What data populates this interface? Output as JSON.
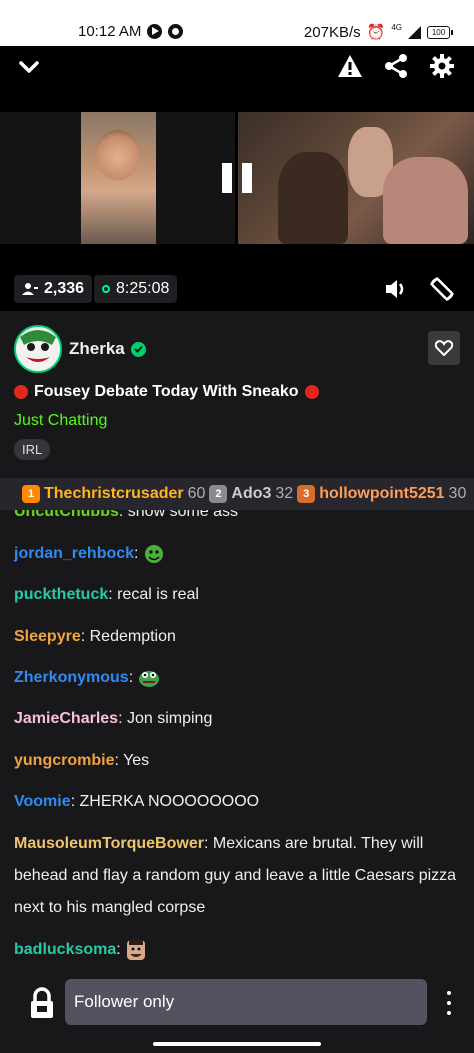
{
  "status_bar": {
    "time": "10:12 AM",
    "net_speed": "207KB/s",
    "network": "4G",
    "battery": "100"
  },
  "video": {
    "viewers": "2,336",
    "uptime": "8:25:08"
  },
  "stream": {
    "streamer": "Zherka",
    "title": "Fousey Debate Today With Sneako",
    "category": "Just Chatting",
    "tag": "IRL"
  },
  "leaderboard": [
    {
      "rank": "1",
      "name": "Thechristcrusader",
      "count": "60",
      "color": "#ffb422"
    },
    {
      "rank": "2",
      "name": "Ado3",
      "count": "32",
      "color": "#c9c9cf"
    },
    {
      "rank": "3",
      "name": "hollowpoint5251",
      "count": "30",
      "color": "#ff9d57"
    }
  ],
  "chat": {
    "messages": [
      {
        "user": "UncutChubbs",
        "sep": ":",
        "text": "show some ass",
        "color": "#6ad41f"
      },
      {
        "user": "jordan_rehbock",
        "sep": ":",
        "text": "",
        "color": "#2e8bf2",
        "emote": "green-face-emote"
      },
      {
        "user": "puckthetuck",
        "sep": ":",
        "text": "recal is real",
        "color": "#27c9a6"
      },
      {
        "user": "Sleepyre",
        "sep": ":",
        "text": "Redemption",
        "color": "#f0a23e"
      },
      {
        "user": "Zherkonymous",
        "sep": ":",
        "text": "",
        "color": "#2e8bf2",
        "emote": "pepe-emote"
      },
      {
        "user": "JamieCharles",
        "sep": ":",
        "text": "Jon simping",
        "color": "#f5c0d8"
      },
      {
        "user": "yungcrombie",
        "sep": ":",
        "text": "Yes",
        "color": "#f0a23e"
      },
      {
        "user": "Voomie",
        "sep": ":",
        "text": "ZHERKA NOOOOOOOO",
        "color": "#2e8bf2"
      },
      {
        "user": "MausoleumTorqueBower",
        "sep": ":",
        "text": "Mexicans are brutal. They will behead and flay a random guy and leave a little Caesars pizza next to his mangled corpse",
        "color": "#f0c46a"
      },
      {
        "user": "badlucksoma",
        "sep": ":",
        "text": "",
        "color": "#27c9a6",
        "emote": "face-emote"
      }
    ]
  },
  "input": {
    "placeholder": "Follower only"
  },
  "colors": {
    "accent": "#53fc18",
    "background": "#18181b",
    "live_red": "#e0281c",
    "verified": "#00d06d"
  }
}
